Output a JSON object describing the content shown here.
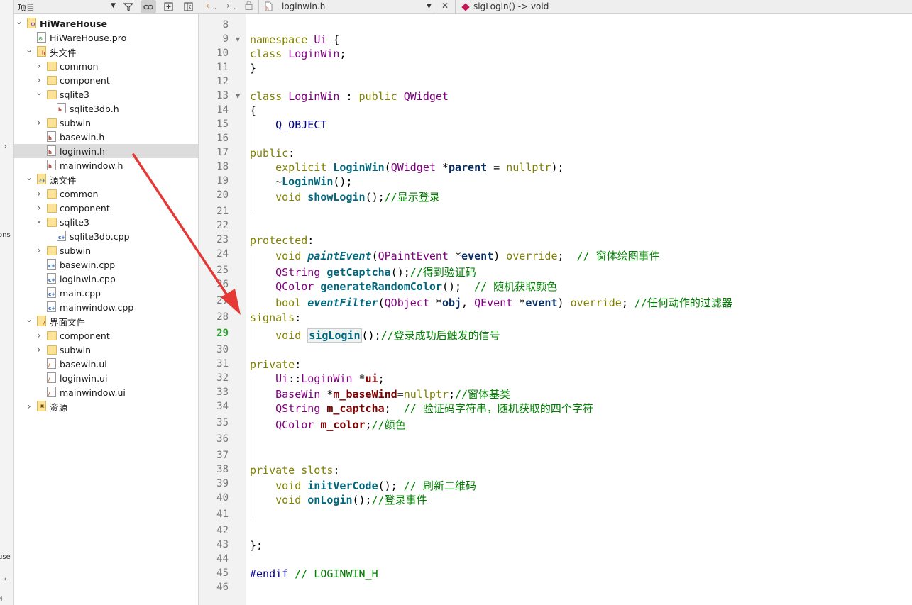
{
  "strip": {
    "frag1": "ons",
    "frag2": "use",
    "frag3": "d"
  },
  "project_panel": {
    "selector_label": "项目",
    "tree": [
      {
        "label": "HiWareHouse",
        "depth": 0,
        "expand": "open",
        "icon": "project",
        "bold": true
      },
      {
        "label": "HiWareHouse.pro",
        "depth": 1,
        "expand": "none",
        "icon": "pro"
      },
      {
        "label": "头文件",
        "depth": 1,
        "expand": "open",
        "icon": "group-h"
      },
      {
        "label": "common",
        "depth": 2,
        "expand": "closed",
        "icon": "folder"
      },
      {
        "label": "component",
        "depth": 2,
        "expand": "closed",
        "icon": "folder"
      },
      {
        "label": "sqlite3",
        "depth": 2,
        "expand": "open",
        "icon": "folder"
      },
      {
        "label": "sqlite3db.h",
        "depth": 3,
        "expand": "none",
        "icon": "h"
      },
      {
        "label": "subwin",
        "depth": 2,
        "expand": "closed",
        "icon": "folder"
      },
      {
        "label": "basewin.h",
        "depth": 2,
        "expand": "none",
        "icon": "h"
      },
      {
        "label": "loginwin.h",
        "depth": 2,
        "expand": "none",
        "icon": "h",
        "selected": true
      },
      {
        "label": "mainwindow.h",
        "depth": 2,
        "expand": "none",
        "icon": "h"
      },
      {
        "label": "源文件",
        "depth": 1,
        "expand": "open",
        "icon": "group-cpp"
      },
      {
        "label": "common",
        "depth": 2,
        "expand": "closed",
        "icon": "folder"
      },
      {
        "label": "component",
        "depth": 2,
        "expand": "closed",
        "icon": "folder"
      },
      {
        "label": "sqlite3",
        "depth": 2,
        "expand": "open",
        "icon": "folder"
      },
      {
        "label": "sqlite3db.cpp",
        "depth": 3,
        "expand": "none",
        "icon": "cpp"
      },
      {
        "label": "subwin",
        "depth": 2,
        "expand": "closed",
        "icon": "folder"
      },
      {
        "label": "basewin.cpp",
        "depth": 2,
        "expand": "none",
        "icon": "cpp"
      },
      {
        "label": "loginwin.cpp",
        "depth": 2,
        "expand": "none",
        "icon": "cpp"
      },
      {
        "label": "main.cpp",
        "depth": 2,
        "expand": "none",
        "icon": "cpp"
      },
      {
        "label": "mainwindow.cpp",
        "depth": 2,
        "expand": "none",
        "icon": "cpp"
      },
      {
        "label": "界面文件",
        "depth": 1,
        "expand": "open",
        "icon": "group-ui"
      },
      {
        "label": "component",
        "depth": 2,
        "expand": "closed",
        "icon": "folder"
      },
      {
        "label": "subwin",
        "depth": 2,
        "expand": "closed",
        "icon": "folder"
      },
      {
        "label": "basewin.ui",
        "depth": 2,
        "expand": "none",
        "icon": "ui"
      },
      {
        "label": "loginwin.ui",
        "depth": 2,
        "expand": "none",
        "icon": "ui"
      },
      {
        "label": "mainwindow.ui",
        "depth": 2,
        "expand": "none",
        "icon": "ui"
      },
      {
        "label": "资源",
        "depth": 1,
        "expand": "closed",
        "icon": "group-res"
      }
    ]
  },
  "editor": {
    "file_name": "loginwin.h",
    "symbol": "sigLogin() -> void",
    "current_line": "29",
    "lines": [
      {
        "n": "8",
        "tokens": []
      },
      {
        "n": "9",
        "fold": true,
        "tokens": [
          [
            "kw",
            "namespace "
          ],
          [
            "ty",
            "Ui"
          ],
          [
            "pl",
            " {"
          ]
        ]
      },
      {
        "n": "10",
        "tokens": [
          [
            "kw",
            "class "
          ],
          [
            "ty",
            "LoginWin"
          ],
          [
            "pl",
            ";"
          ]
        ]
      },
      {
        "n": "11",
        "tokens": [
          [
            "pl",
            "}"
          ]
        ]
      },
      {
        "n": "12",
        "tokens": []
      },
      {
        "n": "13",
        "fold": true,
        "tokens": [
          [
            "kw",
            "class "
          ],
          [
            "ty",
            "LoginWin"
          ],
          [
            "pl",
            " : "
          ],
          [
            "kw",
            "public "
          ],
          [
            "ty",
            "QWidget"
          ]
        ]
      },
      {
        "n": "14",
        "tokens": [
          [
            "pl",
            "{"
          ]
        ]
      },
      {
        "n": "15",
        "tokens": [
          [
            "pl",
            "    "
          ],
          [
            "pp",
            "Q_OBJECT"
          ]
        ]
      },
      {
        "n": "16",
        "tokens": []
      },
      {
        "n": "17",
        "tokens": [
          [
            "kw",
            "public"
          ],
          [
            "pl",
            ":"
          ]
        ]
      },
      {
        "n": "18",
        "tokens": [
          [
            "pl",
            "    "
          ],
          [
            "kw",
            "explicit "
          ],
          [
            "fnb",
            "LoginWin"
          ],
          [
            "pl",
            "("
          ],
          [
            "ty",
            "QWidget"
          ],
          [
            "pl",
            " *"
          ],
          [
            "prm",
            "parent"
          ],
          [
            "pl",
            " = "
          ],
          [
            "kw",
            "nullptr"
          ],
          [
            "pl",
            ");"
          ]
        ]
      },
      {
        "n": "19",
        "tokens": [
          [
            "pl",
            "    ~"
          ],
          [
            "fnb",
            "LoginWin"
          ],
          [
            "pl",
            "();"
          ]
        ]
      },
      {
        "n": "20",
        "tokens": [
          [
            "pl",
            "    "
          ],
          [
            "kw",
            "void "
          ],
          [
            "fnb",
            "showLogin"
          ],
          [
            "pl",
            "();"
          ],
          [
            "cm",
            "//显示登录"
          ]
        ]
      },
      {
        "n": "21",
        "tokens": []
      },
      {
        "n": "22",
        "tokens": []
      },
      {
        "n": "23",
        "tokens": [
          [
            "kw",
            "protected"
          ],
          [
            "pl",
            ":"
          ]
        ]
      },
      {
        "n": "24",
        "tokens": [
          [
            "pl",
            "    "
          ],
          [
            "kw",
            "void "
          ],
          [
            "fi",
            "paintEvent"
          ],
          [
            "pl",
            "("
          ],
          [
            "ty",
            "QPaintEvent"
          ],
          [
            "pl",
            " *"
          ],
          [
            "prm",
            "event"
          ],
          [
            "pl",
            ") "
          ],
          [
            "kw",
            "override"
          ],
          [
            "pl",
            ";  "
          ],
          [
            "cm",
            "// 窗体绘图事件"
          ]
        ]
      },
      {
        "n": "25",
        "tokens": [
          [
            "pl",
            "    "
          ],
          [
            "ty",
            "QString "
          ],
          [
            "fnb",
            "getCaptcha"
          ],
          [
            "pl",
            "();"
          ],
          [
            "cm",
            "//得到验证码"
          ]
        ]
      },
      {
        "n": "26",
        "tokens": [
          [
            "pl",
            "    "
          ],
          [
            "ty",
            "QColor "
          ],
          [
            "fnb",
            "generateRandomColor"
          ],
          [
            "pl",
            "();  "
          ],
          [
            "cm",
            "// 随机获取颜色"
          ]
        ]
      },
      {
        "n": "27",
        "tokens": [
          [
            "pl",
            "    "
          ],
          [
            "kw",
            "bool "
          ],
          [
            "fi",
            "eventFilter"
          ],
          [
            "pl",
            "("
          ],
          [
            "ty",
            "QObject"
          ],
          [
            "pl",
            " *"
          ],
          [
            "prm",
            "obj"
          ],
          [
            "pl",
            ", "
          ],
          [
            "ty",
            "QEvent"
          ],
          [
            "pl",
            " *"
          ],
          [
            "prm",
            "event"
          ],
          [
            "pl",
            ") "
          ],
          [
            "kw",
            "override"
          ],
          [
            "pl",
            "; "
          ],
          [
            "cm",
            "//任何动作的过滤器"
          ]
        ]
      },
      {
        "n": "28",
        "tokens": [
          [
            "kw",
            "signals"
          ],
          [
            "pl",
            ":"
          ]
        ]
      },
      {
        "n": "29",
        "tokens": [
          [
            "pl",
            "    "
          ],
          [
            "kw",
            "void "
          ],
          [
            "hl",
            "sigLogin"
          ],
          [
            "pl",
            "();"
          ],
          [
            "cm",
            "//登录成功后触发的信号"
          ]
        ]
      },
      {
        "n": "30",
        "tokens": []
      },
      {
        "n": "31",
        "tokens": [
          [
            "kw",
            "private"
          ],
          [
            "pl",
            ":"
          ]
        ]
      },
      {
        "n": "32",
        "tokens": [
          [
            "pl",
            "    "
          ],
          [
            "ty",
            "Ui"
          ],
          [
            "pl",
            "::"
          ],
          [
            "ty",
            "LoginWin"
          ],
          [
            "pl",
            " *"
          ],
          [
            "mem",
            "ui"
          ],
          [
            "pl",
            ";"
          ]
        ]
      },
      {
        "n": "33",
        "tokens": [
          [
            "pl",
            "    "
          ],
          [
            "ty",
            "BaseWin"
          ],
          [
            "pl",
            " *"
          ],
          [
            "mem",
            "m_baseWind"
          ],
          [
            "pl",
            "="
          ],
          [
            "kw",
            "nullptr"
          ],
          [
            "pl",
            ";"
          ],
          [
            "cm",
            "//窗体基类"
          ]
        ]
      },
      {
        "n": "34",
        "tokens": [
          [
            "pl",
            "    "
          ],
          [
            "ty",
            "QString "
          ],
          [
            "mem",
            "m_captcha"
          ],
          [
            "pl",
            ";  "
          ],
          [
            "cm",
            "// 验证码字符串，随机获取的四个字符"
          ]
        ]
      },
      {
        "n": "35",
        "tokens": [
          [
            "pl",
            "    "
          ],
          [
            "ty",
            "QColor "
          ],
          [
            "mem",
            "m_color"
          ],
          [
            "pl",
            ";"
          ],
          [
            "cm",
            "//颜色"
          ]
        ]
      },
      {
        "n": "36",
        "tokens": []
      },
      {
        "n": "37",
        "tokens": []
      },
      {
        "n": "38",
        "tokens": [
          [
            "kw",
            "private slots"
          ],
          [
            "pl",
            ":"
          ]
        ]
      },
      {
        "n": "39",
        "tokens": [
          [
            "pl",
            "    "
          ],
          [
            "kw",
            "void "
          ],
          [
            "fnb",
            "initVerCode"
          ],
          [
            "pl",
            "(); "
          ],
          [
            "cm",
            "// 刷新二维码"
          ]
        ]
      },
      {
        "n": "40",
        "tokens": [
          [
            "pl",
            "    "
          ],
          [
            "kw",
            "void "
          ],
          [
            "fnb",
            "onLogin"
          ],
          [
            "pl",
            "();"
          ],
          [
            "cm",
            "//登录事件"
          ]
        ]
      },
      {
        "n": "41",
        "tokens": []
      },
      {
        "n": "42",
        "tokens": []
      },
      {
        "n": "43",
        "tokens": [
          [
            "pl",
            "};"
          ]
        ]
      },
      {
        "n": "44",
        "tokens": []
      },
      {
        "n": "45",
        "tokens": [
          [
            "pp",
            "#endif "
          ],
          [
            "cm",
            "// LOGINWIN_H"
          ]
        ]
      },
      {
        "n": "46",
        "tokens": []
      }
    ]
  },
  "colors": {
    "keyword": "#808000",
    "type": "#800080",
    "function": "#00677c",
    "member": "#800000",
    "comment": "#008000",
    "annotation_arrow": "#e53935"
  }
}
